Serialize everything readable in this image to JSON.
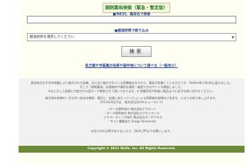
{
  "header": {
    "title": "調剤薬局検索（緊急・暫定版）"
  },
  "search": {
    "label": "■市町村、薬局名で検索",
    "placeholder": ""
  },
  "prefecture": {
    "label": "■都道府県で絞り込み",
    "selected": "都道府県を選択してください"
  },
  "actions": {
    "search_button": "検索"
  },
  "notice_link": "処方薬や市販薬の効果や副作用について調べる（一般向け）",
  "footer": {
    "lines": [
      "東北地方太平洋沖地震により被災された皆様、ならびに被災されている医療者の方々から、薬局が営業しているかどうか、Twitter等でQLifeに届きました。",
      "そこで「調剤薬局」の連絡先や場所を検索・確認できるサイトを開設しました。",
      "※なにかしら変更に付加される度データ更新させて頂いております。※ 営業状況や取扱い製品までに必ずお問い合わせください。",
      "",
      "被災地の皆様の一日も早い安全の確保、復旧と、支援にあたっていらっしゃる医療者の皆様のご安全を、心よりお祈り申し上げます。",
      "2011年3月15日　株式会社QLife(キューライフ)",
      "",
      "・データ提供協力 株式会社ケアネット",
      "・データ提供協力 株式会社エクストランス",
      "・ジオコーディング協力 株式会社コーポクラス",
      "・サイト構築協力 Shogo Yamashita",
      "",
      "お気づきの点等がありましたら、QLife_PRまでお願いします。"
    ]
  },
  "copyright": "Copyright © 2011 QLife, Inc. All Rights Reserved."
}
